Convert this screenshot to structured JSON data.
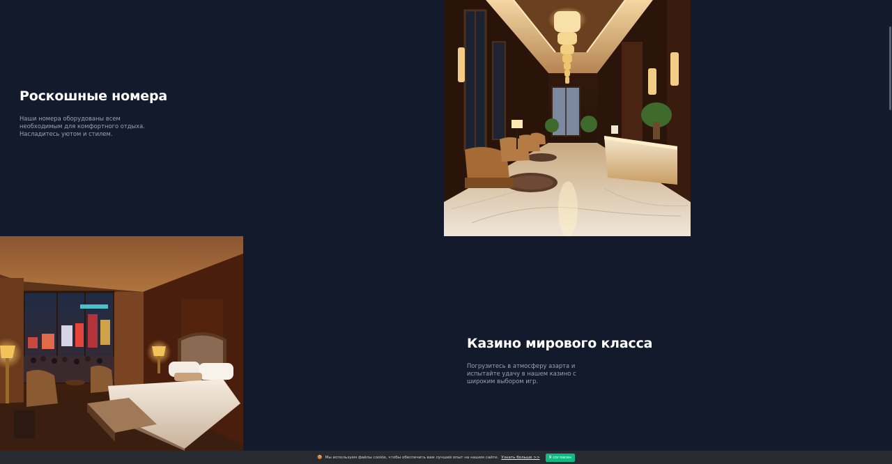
{
  "sections": {
    "rooms": {
      "title": "Роскошные номера",
      "description": "Наши номера оборудованы всем необходимым для комфортного отдыха. Насладитесь уютом и стилем."
    },
    "casino": {
      "title": "Казино мирового класса",
      "description": "Погрузитесь в атмосферу азарта и испытайте удачу в нашем казино с широким выбором игр."
    }
  },
  "images": {
    "lobby": {
      "icon": "hotel-lobby-image"
    },
    "bedroom": {
      "icon": "hotel-bedroom-image"
    }
  },
  "cookie_banner": {
    "emoji": "🍪",
    "message": "Мы используем файлы cookie, чтобы обеспечить вам лучший опыт на нашем сайте.",
    "link_text": "Узнать больше >>",
    "accept_label": "Я согласен"
  },
  "colors": {
    "background": "#121a2b",
    "accent": "#10b981",
    "muted_text": "#9ca3af",
    "banner": "#272a31"
  }
}
